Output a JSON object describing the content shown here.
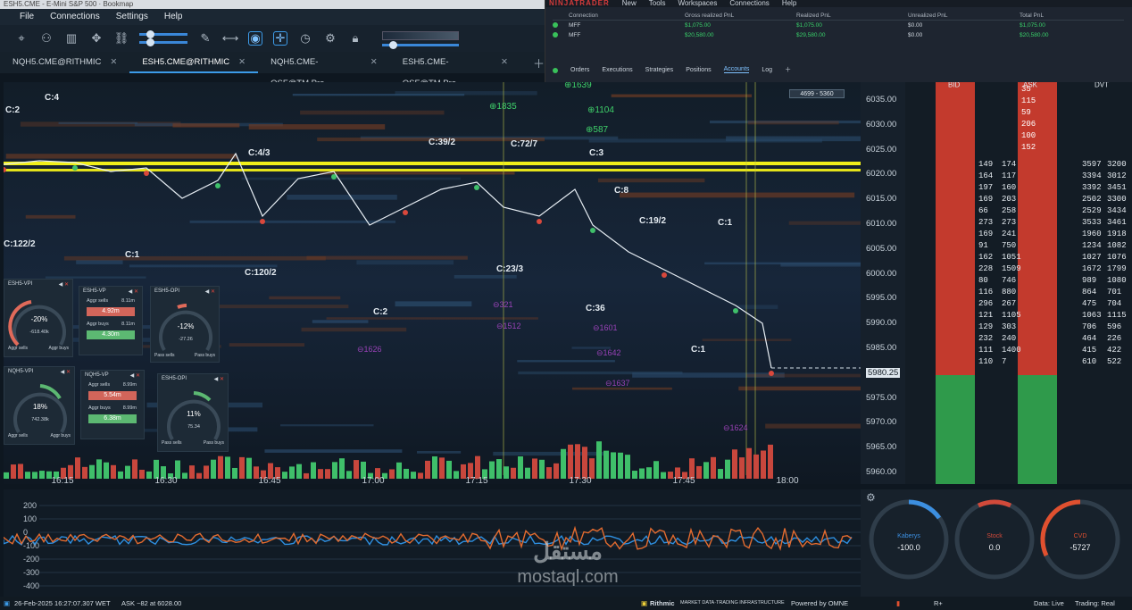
{
  "window": {
    "title": "ESH5.CME - E-Mini S&P 500  ·  Bookmap"
  },
  "menu": [
    "File",
    "Connections",
    "Settings",
    "Help"
  ],
  "toolbar_icons": [
    "crosshair-icon",
    "share-icon",
    "chart-icon",
    "move-icon",
    "link-icon",
    "slider-icon",
    "pencil-icon",
    "measure-icon",
    "chat-icon",
    "cross-icon",
    "clock-icon",
    "indicator-icon",
    "lock-icon"
  ],
  "tabs": [
    {
      "label": "NQH5.CME@RITHMIC",
      "active": false
    },
    {
      "label": "ESH5.CME@RITHMIC",
      "active": true
    },
    {
      "label": "NQH5.CME-OSF@TM.Pro",
      "active": false
    },
    {
      "label": "ESH5.CME-OSF@TM.Pro",
      "active": false
    }
  ],
  "ninjatrader": {
    "logo": "NINJATRADER",
    "menu": [
      "New",
      "Tools",
      "Workspaces",
      "Connections",
      "Help"
    ],
    "columns": [
      "Connection",
      "Gross realized PnL",
      "Realized PnL",
      "Unrealized PnL",
      "Total PnL"
    ],
    "rows": [
      {
        "connection": "MFF",
        "gross": "$1,075.00",
        "realized": "$1,075.00",
        "unrealized": "$0.00",
        "total": "$1,075.00"
      },
      {
        "connection": "MFF",
        "gross": "$20,580.00",
        "realized": "$29,580.00",
        "unrealized": "$0.00",
        "total": "$20,580.00"
      }
    ],
    "tabs": [
      "Orders",
      "Executions",
      "Strategies",
      "Positions",
      "Accounts",
      "Log"
    ],
    "active_tab": "Accounts"
  },
  "chart": {
    "price_box": "4699 - 5360",
    "time_ticks": [
      "16:15",
      "16:30",
      "16:45",
      "17:00",
      "17:15",
      "17:30",
      "17:45",
      "18:00"
    ],
    "labels": [
      "C:2",
      "C:4",
      "C:122/2",
      "C:1",
      "C:4/3",
      "C:120/2",
      "C:2",
      "C:39/2",
      "C:72/7",
      "C:3",
      "C:23/3",
      "C:8",
      "C:19/2",
      "C:36",
      "C:1",
      "C:1"
    ],
    "green_tags": [
      "1835",
      "1104",
      "587",
      "1639"
    ],
    "purple_tags": [
      "321",
      "1512",
      "1626",
      "1601",
      "1642",
      "1637",
      "1624"
    ],
    "current_price": "5980.25"
  },
  "price_axis": [
    "6035.00",
    "6030.00",
    "6025.00",
    "6020.00",
    "6015.00",
    "6010.00",
    "6005.00",
    "6000.00",
    "5995.00",
    "5990.00",
    "5985.00",
    "5980.25",
    "5975.00",
    "5970.00",
    "5965.00",
    "5960.00"
  ],
  "dom": {
    "headers": [
      "BID",
      "ASK",
      "DVT"
    ],
    "ask_sizes": [
      "35",
      "115",
      "59",
      "206",
      "100",
      "152"
    ],
    "rows": [
      [
        "149",
        "174",
        "3597",
        "3200"
      ],
      [
        "164",
        "117",
        "3394",
        "3012"
      ],
      [
        "197",
        "160",
        "3392",
        "3451"
      ],
      [
        "169",
        "203",
        "2502",
        "3300"
      ],
      [
        "66",
        "258",
        "2529",
        "3434"
      ],
      [
        "273",
        "273",
        "3533",
        "3461"
      ],
      [
        "169",
        "241",
        "1960",
        "1918"
      ],
      [
        "91",
        "750",
        "1234",
        "1082"
      ],
      [
        "162",
        "1051",
        "1027",
        "1076"
      ],
      [
        "228",
        "1509",
        "1672",
        "1799"
      ],
      [
        "80",
        "746",
        "989",
        "1080"
      ],
      [
        "116",
        "880",
        "864",
        "701"
      ],
      [
        "296",
        "267",
        "475",
        "704"
      ],
      [
        "121",
        "1105",
        "1063",
        "1115"
      ],
      [
        "129",
        "303",
        "706",
        "596"
      ],
      [
        "232",
        "240",
        "464",
        "226"
      ],
      [
        "111",
        "1400",
        "415",
        "422"
      ],
      [
        "110",
        "7",
        "610",
        "522"
      ]
    ]
  },
  "widgets": [
    {
      "title": "ESH5-VPI",
      "value": "-20%",
      "sub": "-618.40k",
      "left": "Aggr sells",
      "right": "Aggr buys"
    },
    {
      "title": "ESH5-VP",
      "sells_label": "Aggr sells",
      "sells": "4.92m",
      "sells_total": "8.11m",
      "buys_label": "Aggr buys",
      "buys": "4.30m",
      "buys_total": "8.11m"
    },
    {
      "title": "ESH5-OPI",
      "value": "-12%",
      "sub": "-27.26",
      "left": "Pass sells",
      "right": "Pass buys"
    },
    {
      "title": "NQH5-VPI",
      "value": "18%",
      "sub": "742.38k",
      "left": "Aggr sells",
      "right": "Aggr buys"
    },
    {
      "title": "NQH5-VP",
      "sells_label": "Aggr sells",
      "sells": "5.54m",
      "sells_total": "8.99m",
      "buys_label": "Aggr buys",
      "buys": "6.38m",
      "buys_total": "8.99m"
    },
    {
      "title": "ESH5-OPI",
      "value": "11%",
      "sub": "75.34",
      "left": "Pass sells",
      "right": "Pass buys"
    }
  ],
  "lower_axis": [
    "200",
    "100",
    "0",
    "-100",
    "-200",
    "-300",
    "-400"
  ],
  "gauges": [
    {
      "label": "Kaberys",
      "value": "-100.0",
      "color": "#3c8fe0"
    },
    {
      "label": "Stock",
      "value": "0.0",
      "color": "#d24a3a"
    },
    {
      "label": "CVD",
      "value": "-5727",
      "color": "#e0502f"
    }
  ],
  "status": {
    "datetime": "26-Feb-2025 16:27:07.307 WET",
    "ask": "ASK ~82 at 6028.00",
    "provider": "Rithmic",
    "provider_sub": "MARKET DATA·TRADING INFRASTRUCTURE",
    "powered": "Powered by OMNE",
    "data": "Data: Live",
    "trading": "Trading: Real"
  },
  "watermark": {
    "text": "mostaql.com",
    "arabic": "مستقل"
  }
}
